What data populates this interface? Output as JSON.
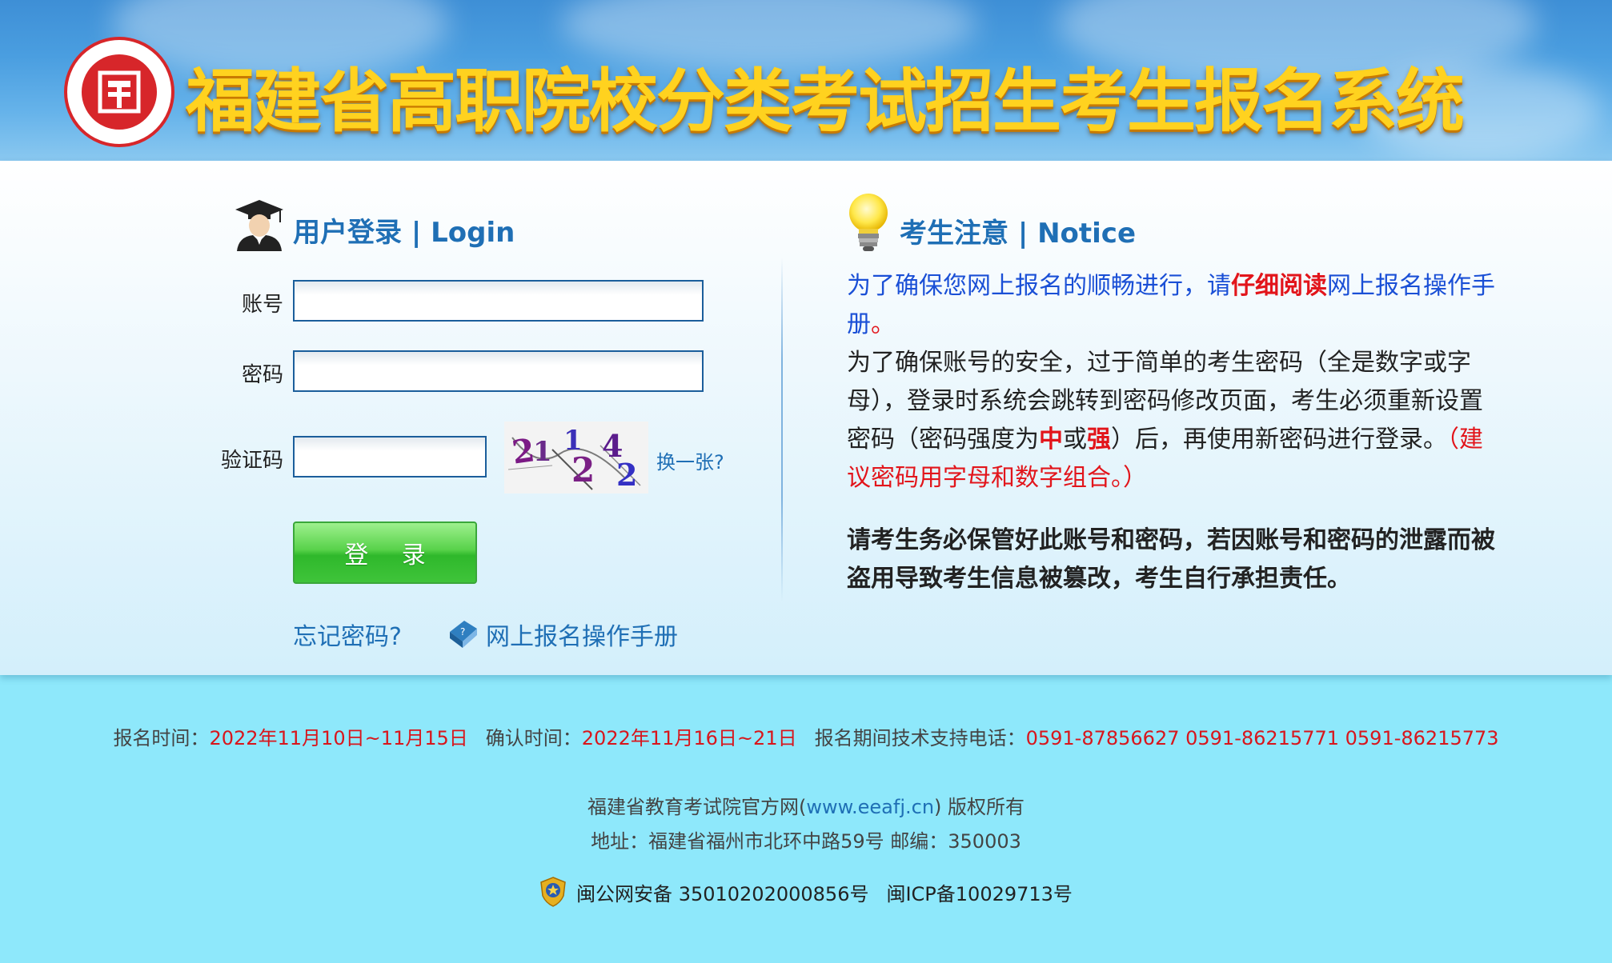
{
  "header": {
    "title": "福建省高职院校分类考试招生考生报名系统"
  },
  "login": {
    "heading": "用户登录 | Login",
    "account_label": "账号",
    "account_value": "",
    "password_label": "密码",
    "password_value": "",
    "captcha_label": "验证码",
    "captcha_value": "",
    "captcha_chars": [
      "2",
      "1",
      "1",
      "2",
      "4",
      "2"
    ],
    "refresh_captcha": "换一张?",
    "login_button": "登 录",
    "forgot_password": "忘记密码?",
    "manual_link": "网上报名操作手册"
  },
  "notice": {
    "heading": "考生注意 | Notice",
    "p1_part1": "为了确保您网上报名的顺畅进行，请",
    "p1_part2": "仔细阅读",
    "p1_part3": "网上报名操作手册",
    "p1_part4": "。",
    "p2_part1": "为了确保账号的安全，过于简单的考生密码（全是数字或字母），登录时系统会跳转到密码修改页面，考生必须重新设置密码（密码强度为",
    "p2_part2": "中",
    "p2_part3": "或",
    "p2_part4": "强",
    "p2_part5": "）后，再使用新密码进行登录。",
    "p2_part6": "（建议密码用字母和数字组合。）",
    "p3": "请考生务必保管好此账号和密码，若因账号和密码的泄露而被 盗用导致考生信息被篡改，考生自行承担责任。"
  },
  "footer": {
    "reg_time_label": "报名时间：",
    "reg_time_value": "2022年11月10日~11月15日",
    "confirm_time_label": "确认时间：",
    "confirm_time_value": "2022年11月16日~21日",
    "support_label": "报名期间技术支持电话：",
    "support_value": "0591-87856627 0591-86215771 0591-86215773",
    "copyright_part1": "福建省教育考试院官方网(",
    "copyright_link": "www.eeafj.cn",
    "copyright_part2": ") 版权所有",
    "address": "地址：福建省福州市北环中路59号 邮编：350003",
    "police_record": "闽公网安备 35010202000856号",
    "icp_record": "闽ICP备10029713号"
  },
  "colors": {
    "brand_blue": "#1f6fb5",
    "accent_red": "#e2151b",
    "button_green": "#3fc43a",
    "footer_bg": "#8ee8fb"
  }
}
